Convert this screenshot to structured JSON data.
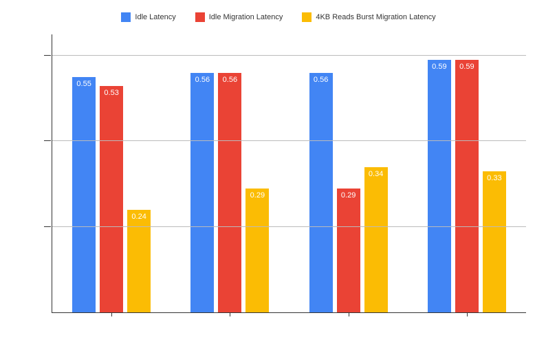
{
  "chart_data": {
    "type": "bar",
    "title": "",
    "xlabel": "",
    "ylabel": "",
    "ylim": [
      0,
      0.65
    ],
    "gridlines": [
      0.2,
      0.4,
      0.6
    ],
    "categories": [
      "",
      "",
      "",
      ""
    ],
    "series": [
      {
        "name": "Idle Latency",
        "color": "#4285F4",
        "values": [
          0.55,
          0.56,
          0.56,
          0.59
        ]
      },
      {
        "name": "Idle Migration Latency",
        "color": "#EA4335",
        "values": [
          0.53,
          0.56,
          0.29,
          0.59
        ]
      },
      {
        "name": "4KB Reads Burst Migration Latency",
        "color": "#FBBC04",
        "values": [
          0.24,
          0.29,
          0.34,
          0.33
        ]
      }
    ]
  }
}
